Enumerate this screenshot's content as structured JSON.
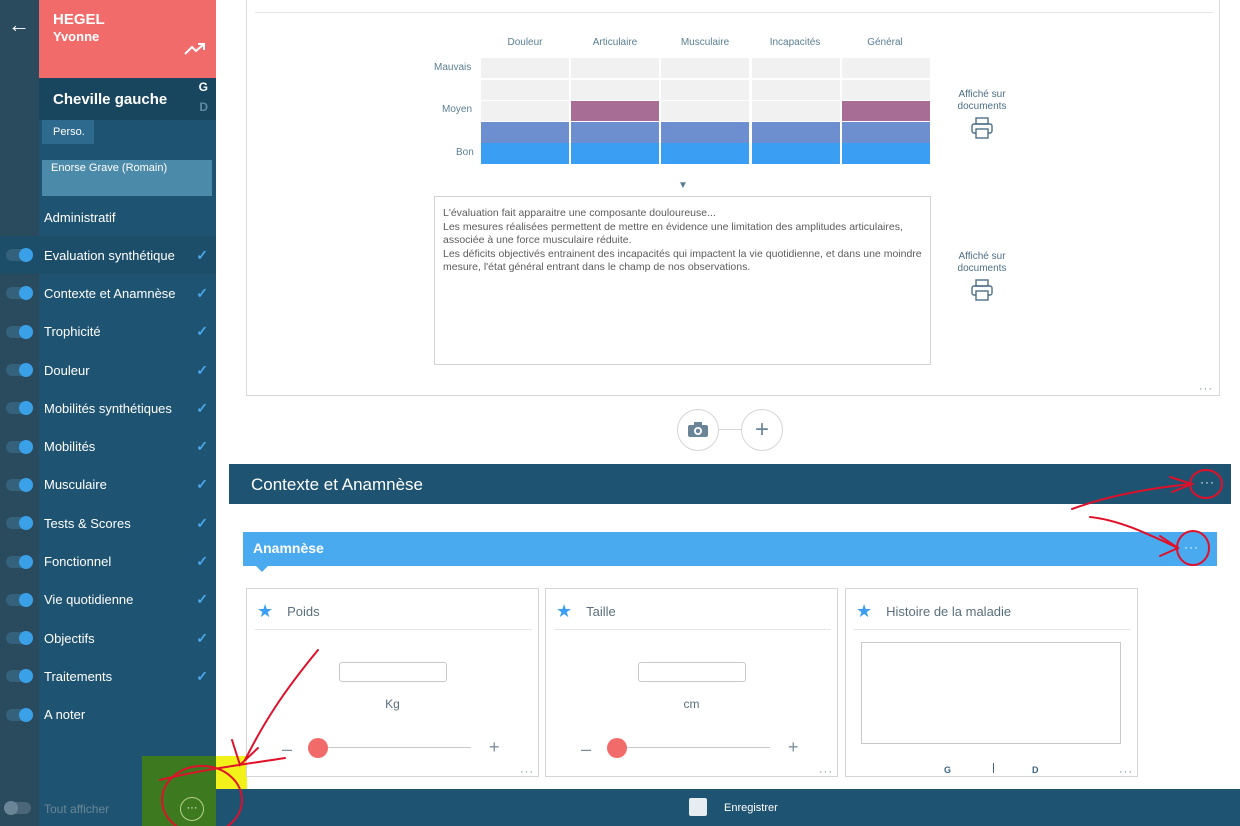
{
  "patient": {
    "last_name": "HEGEL",
    "first_name": "Yvonne"
  },
  "zone": {
    "name": "Cheville gauche",
    "side_g": "G",
    "side_d": "D"
  },
  "tabs": {
    "perso": "Perso."
  },
  "diagnosis": "Enorse Grave (Romain)",
  "nav": {
    "admin": "Administratif",
    "items": [
      "Evaluation synthétique",
      "Contexte et Anamnèse",
      "Trophicité",
      "Douleur",
      "Mobilités synthétiques",
      "Mobilités",
      "Musculaire",
      "Tests & Scores",
      "Fonctionnel",
      "Vie quotidienne",
      "Objectifs",
      "Traitements",
      "A noter"
    ],
    "show_all": "Tout afficher",
    "more": "···"
  },
  "chart_data": {
    "type": "bar",
    "categories": [
      "Douleur",
      "Articulaire",
      "Musculaire",
      "Incapacités",
      "Général"
    ],
    "levels": [
      "Mauvais",
      "Moyen",
      "Bon"
    ],
    "values": [
      "Bon",
      "Moyen",
      "Bon",
      "Bon",
      "Moyen"
    ],
    "colors": {
      "bon": "#3a9ef2",
      "intermediate": "#6e8fcf",
      "moyen": "#a76d94"
    }
  },
  "evaluation": {
    "notes": [
      "L'évaluation fait apparaitre une composante douloureuse...",
      "Les mesures réalisées permettent de mettre en évidence une limitation des amplitudes articulaires, associée à une force musculaire réduite.",
      "Les déficits objectivés entrainent des incapacités qui impactent la vie quotidienne, et dans une moindre mesure, l'état général entrant dans le champ de nos observations."
    ],
    "print_label_1": "Affiché sur",
    "print_label_2": "documents"
  },
  "section": {
    "title": "Contexte et Anamnèse",
    "more": "···"
  },
  "subsection": {
    "title": "Anamnèse",
    "more": "···"
  },
  "widgets": {
    "poids": {
      "title": "Poids",
      "unit": "Kg"
    },
    "taille": {
      "title": "Taille",
      "unit": "cm"
    },
    "histoire": {
      "title": "Histoire de la maladie",
      "g": "G",
      "d": "D"
    }
  },
  "footer": {
    "save": "Enregistrer"
  },
  "dots": "···"
}
